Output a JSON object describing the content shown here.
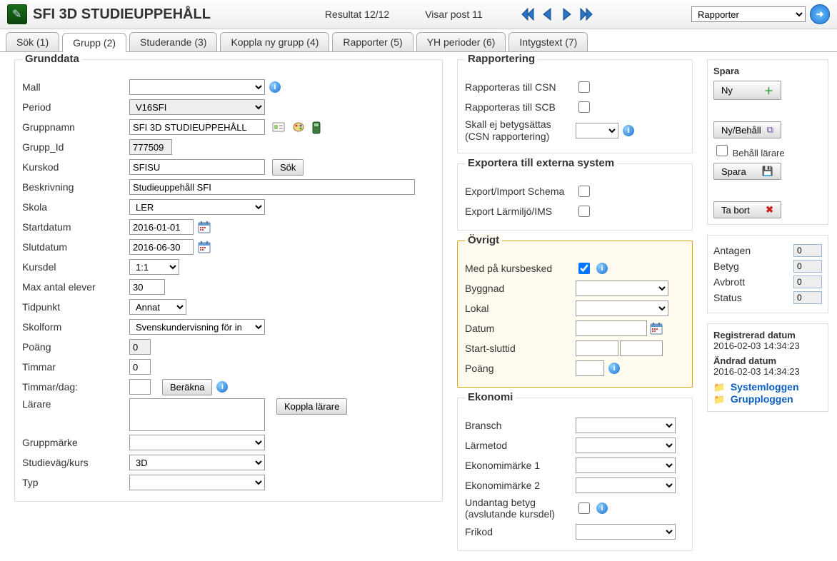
{
  "header": {
    "title": "SFI 3D STUDIEUPPEHÅLL",
    "result_text": "Resultat 12/12",
    "post_text": "Visar post 11",
    "dropdown_value": "Rapporter"
  },
  "tabs": [
    "Sök (1)",
    "Grupp (2)",
    "Studerande (3)",
    "Koppla ny grupp (4)",
    "Rapporter (5)",
    "YH perioder (6)",
    "Intygstext (7)"
  ],
  "grunddata": {
    "legend": "Grunddata",
    "mall_label": "Mall",
    "period_label": "Period",
    "period_value": "V16SFI",
    "gruppnamn_label": "Gruppnamn",
    "gruppnamn_value": "SFI 3D STUDIEUPPEHÅLL",
    "gruppid_label": "Grupp_Id",
    "gruppid_value": "777509",
    "kurskod_label": "Kurskod",
    "kurskod_value": "SFISU",
    "sok_button": "Sök",
    "beskrivning_label": "Beskrivning",
    "beskrivning_value": "Studieuppehåll SFI",
    "skola_label": "Skola",
    "skola_value": "LER",
    "startdatum_label": "Startdatum",
    "startdatum_value": "2016-01-01",
    "slutdatum_label": "Slutdatum",
    "slutdatum_value": "2016-06-30",
    "kursdel_label": "Kursdel",
    "kursdel_value": "1:1",
    "maxelever_label": "Max antal elever",
    "maxelever_value": "30",
    "tidpunkt_label": "Tidpunkt",
    "tidpunkt_value": "Annat",
    "skolform_label": "Skolform",
    "skolform_value": "Svenskundervisning för in",
    "poang_label": "Poäng",
    "poang_value": "0",
    "timmar_label": "Timmar",
    "timmar_value": "0",
    "timmarperdag_label": "Timmar/dag:",
    "berakna_button": "Beräkna",
    "larare_label": "Lärare",
    "koppla_larare_button": "Koppla lärare",
    "gruppmarke_label": "Gruppmärke",
    "studievag_label": "Studieväg/kurs",
    "studievag_value": "3D",
    "typ_label": "Typ"
  },
  "rapportering": {
    "legend": "Rapportering",
    "csn_label": "Rapporteras till CSN",
    "scb_label": "Rapporteras till SCB",
    "skall_ej_label": "Skall ej betygsättas (CSN rapportering)"
  },
  "exportera": {
    "legend": "Exportera till externa system",
    "schema_label": "Export/Import Schema",
    "larmiljo_label": "Export Lärmiljö/IMS"
  },
  "ovrigt": {
    "legend": "Övrigt",
    "kursbesked_label": "Med på kursbesked",
    "byggnad_label": "Byggnad",
    "lokal_label": "Lokal",
    "datum_label": "Datum",
    "startslut_label": "Start-sluttid",
    "poang_label": "Poäng"
  },
  "ekonomi": {
    "legend": "Ekonomi",
    "bransch_label": "Bransch",
    "larmetod_label": "Lärmetod",
    "eko1_label": "Ekonomimärke 1",
    "eko2_label": "Ekonomimärke 2",
    "undantag_label": "Undantag betyg (avslutande kursdel)",
    "frikod_label": "Frikod"
  },
  "spara": {
    "legend": "Spara",
    "ny": "Ny",
    "nybehall": "Ny/Behåll",
    "behall_larare": "Behåll lärare",
    "spara": "Spara",
    "tabort": "Ta bort"
  },
  "stats": {
    "antagen_label": "Antagen",
    "antagen_value": "0",
    "betyg_label": "Betyg",
    "betyg_value": "0",
    "avbrott_label": "Avbrott",
    "avbrott_value": "0",
    "status_label": "Status",
    "status_value": "0"
  },
  "dates": {
    "registrerad_label": "Registrerad datum",
    "registrerad_value": "2016-02-03 14:34:23",
    "andrad_label": "Ändrad datum",
    "andrad_value": "2016-02-03 14:34:23",
    "systemloggen": "Systemloggen",
    "grupploggen": "Grupploggen"
  }
}
